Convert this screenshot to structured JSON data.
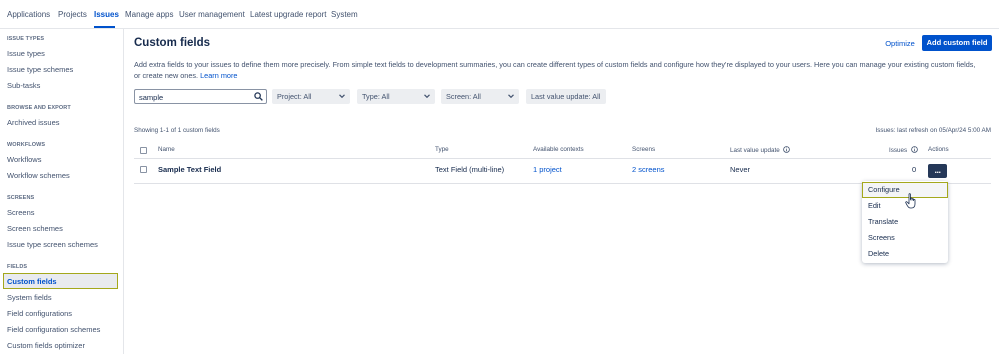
{
  "topnav": {
    "items": [
      "Applications",
      "Projects",
      "Issues",
      "Manage apps",
      "User management",
      "Latest upgrade report",
      "System"
    ],
    "active": "Issues"
  },
  "sidebar": {
    "sections": [
      {
        "title": "ISSUE TYPES",
        "items": [
          "Issue types",
          "Issue type schemes",
          "Sub-tasks"
        ]
      },
      {
        "title": "BROWSE AND EXPORT",
        "items": [
          "Archived issues"
        ]
      },
      {
        "title": "WORKFLOWS",
        "items": [
          "Workflows",
          "Workflow schemes"
        ]
      },
      {
        "title": "SCREENS",
        "items": [
          "Screens",
          "Screen schemes",
          "Issue type screen schemes"
        ]
      },
      {
        "title": "FIELDS",
        "items": [
          "Custom fields",
          "System fields",
          "Field configurations",
          "Field configuration schemes",
          "Custom fields optimizer"
        ]
      }
    ],
    "active_item": "Custom fields"
  },
  "main": {
    "title": "Custom fields",
    "description_line1": "Add extra fields to your issues to define them more precisely. From simple text fields to development summaries, you can create different types of custom fields and configure how they're displayed to your users. Here you can manage your existing custom fields,",
    "description_line2": "or create new ones.",
    "learn_more": "Learn more",
    "optimize_label": "Optimize",
    "add_label": "Add custom field"
  },
  "filters": {
    "search_value": "sample",
    "project": "Project: All",
    "type": "Type: All",
    "screen": "Screen: All",
    "last_value_update": "Last value update: All"
  },
  "summary": {
    "showing": "Showing 1-1 of 1 custom fields",
    "last_refresh": "Issues: last refresh on 05/Apr/24 5:00 AM"
  },
  "table": {
    "headers": {
      "name": "Name",
      "type": "Type",
      "contexts": "Available contexts",
      "screens": "Screens",
      "last_value_update": "Last value update",
      "issues": "Issues",
      "actions": "Actions"
    },
    "rows": [
      {
        "name": "Sample Text Field",
        "type": "Text Field (multi-line)",
        "contexts": "1 project",
        "screens": "2 screens",
        "last_value_update": "Never",
        "issues": "0",
        "actions": "..."
      }
    ]
  },
  "action_menu": {
    "items": [
      "Configure",
      "Edit",
      "Translate",
      "Screens",
      "Delete"
    ],
    "highlighted": "Configure"
  },
  "colors": {
    "brand": "#0052cc",
    "highlight_border": "#a4a81c",
    "actions_button": "#253858"
  }
}
